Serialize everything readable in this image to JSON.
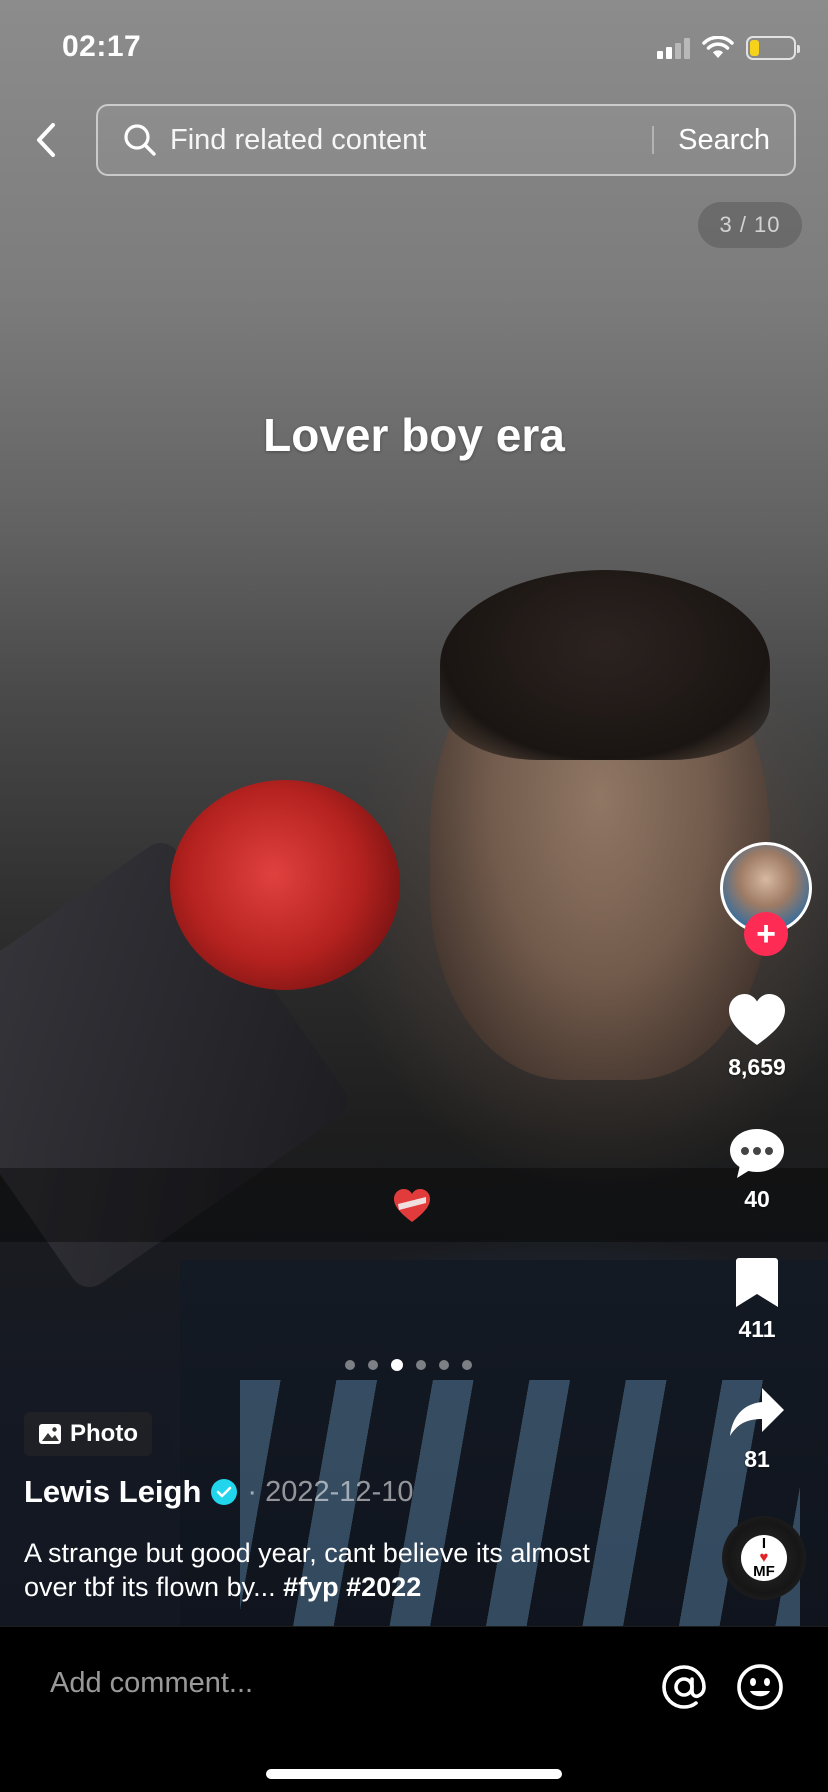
{
  "status_bar": {
    "time": "02:17"
  },
  "search": {
    "placeholder": "Find related content",
    "button_label": "Search"
  },
  "page_counter": "3 / 10",
  "overlay_text": "Lover boy era",
  "carousel": {
    "total": 6,
    "active_index": 2
  },
  "actions": {
    "likes": "8,659",
    "comments": "40",
    "saves": "411",
    "shares": "81"
  },
  "post": {
    "type_badge": "Photo",
    "author": "Lewis Leigh",
    "date": "· 2022-12-10",
    "description": "A strange but good year, cant believe its almost over tbf its flown by... ",
    "hashtags": "#fyp #2022"
  },
  "music_disc": {
    "line1": "I",
    "line2": "MF"
  },
  "comment_bar": {
    "placeholder": "Add comment..."
  },
  "colors": {
    "follow": "#fe2c55",
    "verified": "#20d5ec",
    "battery": "#f7d21a"
  }
}
